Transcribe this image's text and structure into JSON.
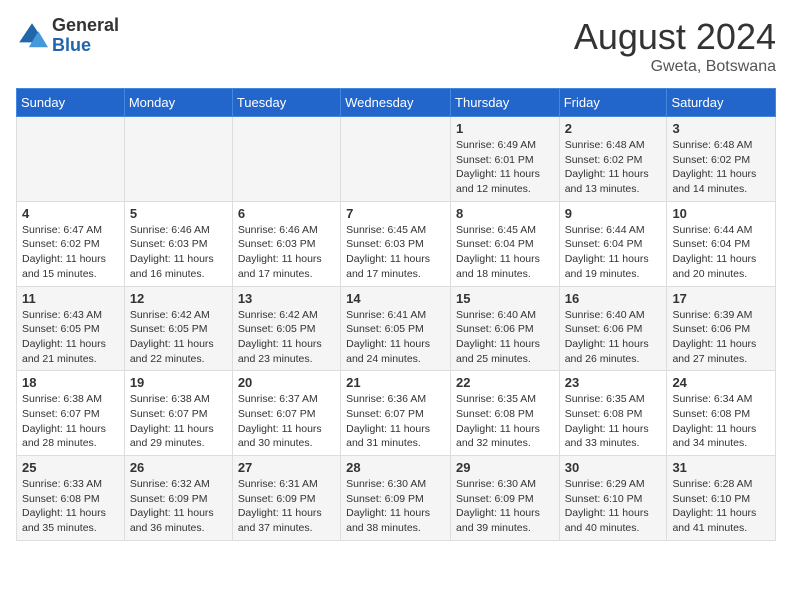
{
  "logo": {
    "general": "General",
    "blue": "Blue"
  },
  "header": {
    "month_year": "August 2024",
    "location": "Gweta, Botswana"
  },
  "days_of_week": [
    "Sunday",
    "Monday",
    "Tuesday",
    "Wednesday",
    "Thursday",
    "Friday",
    "Saturday"
  ],
  "weeks": [
    [
      {
        "day": "",
        "info": ""
      },
      {
        "day": "",
        "info": ""
      },
      {
        "day": "",
        "info": ""
      },
      {
        "day": "",
        "info": ""
      },
      {
        "day": "1",
        "info": "Sunrise: 6:49 AM\nSunset: 6:01 PM\nDaylight: 11 hours\nand 12 minutes."
      },
      {
        "day": "2",
        "info": "Sunrise: 6:48 AM\nSunset: 6:02 PM\nDaylight: 11 hours\nand 13 minutes."
      },
      {
        "day": "3",
        "info": "Sunrise: 6:48 AM\nSunset: 6:02 PM\nDaylight: 11 hours\nand 14 minutes."
      }
    ],
    [
      {
        "day": "4",
        "info": "Sunrise: 6:47 AM\nSunset: 6:02 PM\nDaylight: 11 hours\nand 15 minutes."
      },
      {
        "day": "5",
        "info": "Sunrise: 6:46 AM\nSunset: 6:03 PM\nDaylight: 11 hours\nand 16 minutes."
      },
      {
        "day": "6",
        "info": "Sunrise: 6:46 AM\nSunset: 6:03 PM\nDaylight: 11 hours\nand 17 minutes."
      },
      {
        "day": "7",
        "info": "Sunrise: 6:45 AM\nSunset: 6:03 PM\nDaylight: 11 hours\nand 17 minutes."
      },
      {
        "day": "8",
        "info": "Sunrise: 6:45 AM\nSunset: 6:04 PM\nDaylight: 11 hours\nand 18 minutes."
      },
      {
        "day": "9",
        "info": "Sunrise: 6:44 AM\nSunset: 6:04 PM\nDaylight: 11 hours\nand 19 minutes."
      },
      {
        "day": "10",
        "info": "Sunrise: 6:44 AM\nSunset: 6:04 PM\nDaylight: 11 hours\nand 20 minutes."
      }
    ],
    [
      {
        "day": "11",
        "info": "Sunrise: 6:43 AM\nSunset: 6:05 PM\nDaylight: 11 hours\nand 21 minutes."
      },
      {
        "day": "12",
        "info": "Sunrise: 6:42 AM\nSunset: 6:05 PM\nDaylight: 11 hours\nand 22 minutes."
      },
      {
        "day": "13",
        "info": "Sunrise: 6:42 AM\nSunset: 6:05 PM\nDaylight: 11 hours\nand 23 minutes."
      },
      {
        "day": "14",
        "info": "Sunrise: 6:41 AM\nSunset: 6:05 PM\nDaylight: 11 hours\nand 24 minutes."
      },
      {
        "day": "15",
        "info": "Sunrise: 6:40 AM\nSunset: 6:06 PM\nDaylight: 11 hours\nand 25 minutes."
      },
      {
        "day": "16",
        "info": "Sunrise: 6:40 AM\nSunset: 6:06 PM\nDaylight: 11 hours\nand 26 minutes."
      },
      {
        "day": "17",
        "info": "Sunrise: 6:39 AM\nSunset: 6:06 PM\nDaylight: 11 hours\nand 27 minutes."
      }
    ],
    [
      {
        "day": "18",
        "info": "Sunrise: 6:38 AM\nSunset: 6:07 PM\nDaylight: 11 hours\nand 28 minutes."
      },
      {
        "day": "19",
        "info": "Sunrise: 6:38 AM\nSunset: 6:07 PM\nDaylight: 11 hours\nand 29 minutes."
      },
      {
        "day": "20",
        "info": "Sunrise: 6:37 AM\nSunset: 6:07 PM\nDaylight: 11 hours\nand 30 minutes."
      },
      {
        "day": "21",
        "info": "Sunrise: 6:36 AM\nSunset: 6:07 PM\nDaylight: 11 hours\nand 31 minutes."
      },
      {
        "day": "22",
        "info": "Sunrise: 6:35 AM\nSunset: 6:08 PM\nDaylight: 11 hours\nand 32 minutes."
      },
      {
        "day": "23",
        "info": "Sunrise: 6:35 AM\nSunset: 6:08 PM\nDaylight: 11 hours\nand 33 minutes."
      },
      {
        "day": "24",
        "info": "Sunrise: 6:34 AM\nSunset: 6:08 PM\nDaylight: 11 hours\nand 34 minutes."
      }
    ],
    [
      {
        "day": "25",
        "info": "Sunrise: 6:33 AM\nSunset: 6:08 PM\nDaylight: 11 hours\nand 35 minutes."
      },
      {
        "day": "26",
        "info": "Sunrise: 6:32 AM\nSunset: 6:09 PM\nDaylight: 11 hours\nand 36 minutes."
      },
      {
        "day": "27",
        "info": "Sunrise: 6:31 AM\nSunset: 6:09 PM\nDaylight: 11 hours\nand 37 minutes."
      },
      {
        "day": "28",
        "info": "Sunrise: 6:30 AM\nSunset: 6:09 PM\nDaylight: 11 hours\nand 38 minutes."
      },
      {
        "day": "29",
        "info": "Sunrise: 6:30 AM\nSunset: 6:09 PM\nDaylight: 11 hours\nand 39 minutes."
      },
      {
        "day": "30",
        "info": "Sunrise: 6:29 AM\nSunset: 6:10 PM\nDaylight: 11 hours\nand 40 minutes."
      },
      {
        "day": "31",
        "info": "Sunrise: 6:28 AM\nSunset: 6:10 PM\nDaylight: 11 hours\nand 41 minutes."
      }
    ]
  ]
}
